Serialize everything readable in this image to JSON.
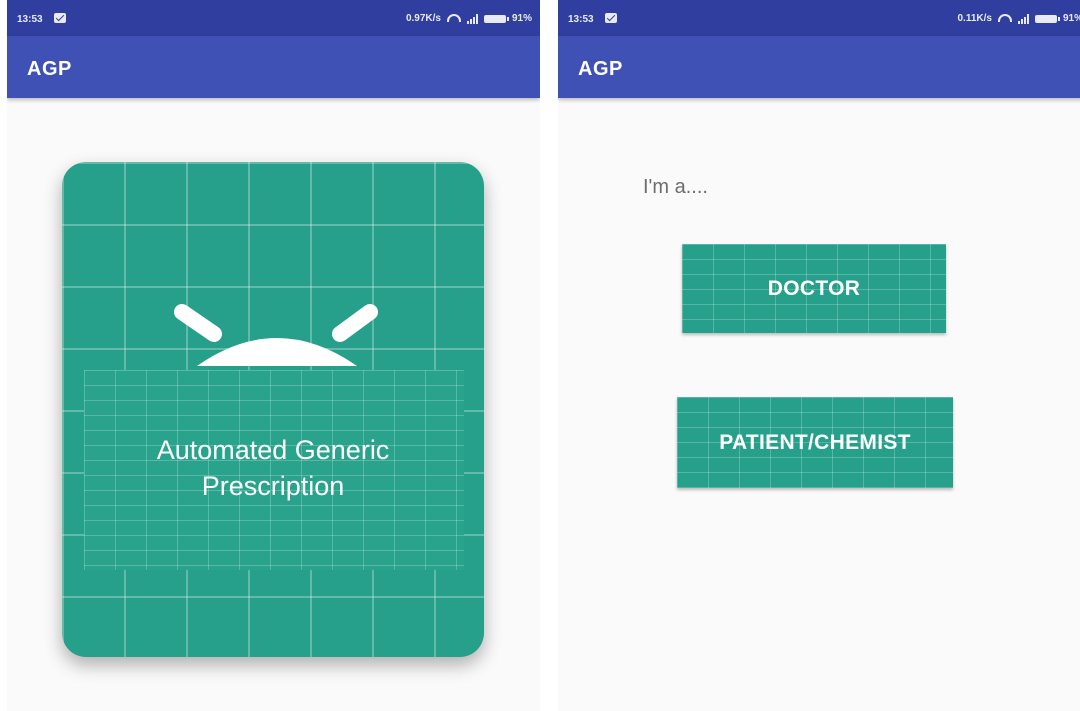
{
  "screens": [
    {
      "status_bar": {
        "time": "13:53",
        "speed": "0.97K/s",
        "battery": "91%",
        "icons": [
          "message-icon",
          "wifi-icon",
          "signal-icon",
          "battery-icon"
        ]
      },
      "app_bar": {
        "title": "AGP"
      },
      "splash": {
        "line1": "Automated Generic",
        "line2": "Prescription"
      }
    },
    {
      "status_bar": {
        "time": "13:53",
        "speed": "0.11K/s",
        "battery": "91%",
        "icons": [
          "message-icon",
          "wifi-icon",
          "signal-icon",
          "battery-icon"
        ]
      },
      "app_bar": {
        "title": "AGP"
      },
      "prompt": "I'm a....",
      "buttons": {
        "doctor": "DOCTOR",
        "patient": "PATIENT/CHEMIST"
      }
    }
  ],
  "colors": {
    "status_bar": "#303f9f",
    "app_bar": "#3f51b5",
    "accent": "#26a08a",
    "background": "#fafafa"
  }
}
